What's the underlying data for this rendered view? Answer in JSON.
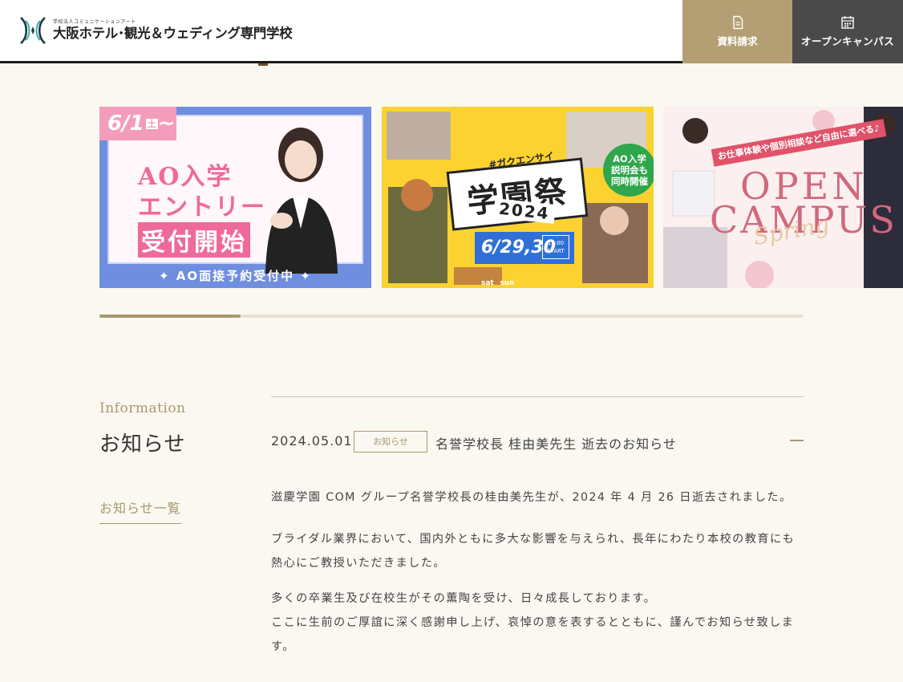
{
  "header": {
    "logo_sub": "学校法人コミュニケーションアート",
    "logo_main": "大阪ホテル･観光＆ウェディング専門学校",
    "docs_button": "資料請求",
    "opencampus_button": "オープンキャンパス",
    "colors": {
      "docs_bg": "#b49e73",
      "opencampus_bg": "#4a4a4a"
    }
  },
  "banners": [
    {
      "date": "6/1",
      "day": "土",
      "tilde": "~",
      "line1": "AO入学",
      "line2": "エントリー",
      "line3": "受付開始",
      "footer": "✦ AO面接予約受付中 ✦"
    },
    {
      "tag": "#ガクエンサイ",
      "title": "学園祭",
      "year": "2024",
      "circle": [
        "AO入学",
        "説明会も",
        "同時開催"
      ],
      "date": "6/29,30",
      "day_sat": "sat",
      "day_sun": "sun",
      "start_time": "11:00",
      "start_label": "START"
    },
    {
      "ribbon": "お仕事体験や個別相談など自由に選べる♪",
      "line1": "OPEN",
      "line2": "CAMPUS",
      "script": "Spring"
    }
  ],
  "slider": {
    "progress": 0.2
  },
  "info": {
    "heading_en": "Information",
    "heading_ja": "お知らせ",
    "list_link": "お知らせ一覧"
  },
  "news": {
    "date": "2024.05.01",
    "badge": "お知らせ",
    "title": "名誉学校長 桂由美先生 逝去のお知らせ",
    "paragraphs": [
      "滋慶学園 COM グループ名誉学校長の桂由美先生が、2024 年 4 月 26 日逝去されました。",
      "ブライダル業界において、国内外ともに多大な影響を与えられ、長年にわたり本校の教育にも熱心にご教授いただきました。",
      "多くの卒業生及び在校生がその薫陶を受け、日々成長しております。ここに生前のご厚誼に深く感謝申し上げ、哀悼の意を表するとともに、謹んでお知らせ致します。"
    ],
    "paragraph3_lines": [
      "多くの卒業生及び在校生がその薫陶を受け、日々成長しております。",
      "ここに生前のご厚誼に深く感謝申し上げ、哀悼の意を表するとともに、謹んでお知らせ致します。"
    ]
  },
  "icons": {
    "docs": "document-icon",
    "opencampus": "calendar-icon",
    "toggle": "minus-icon"
  }
}
